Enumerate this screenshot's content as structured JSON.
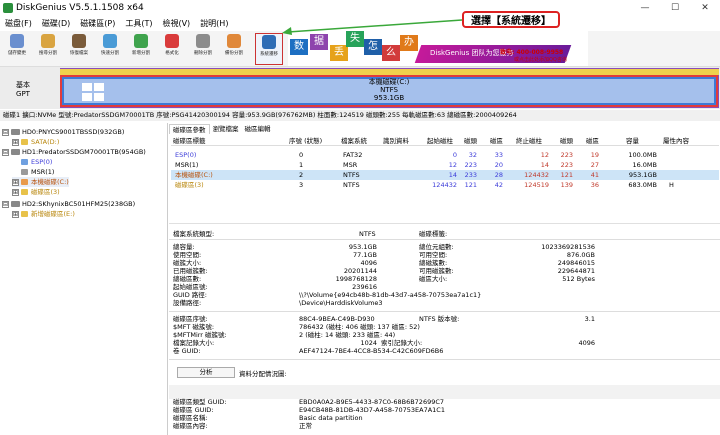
{
  "window": {
    "title": "DiskGenius V5.5.1.1508 x64",
    "minimize": "—",
    "maximize": "☐",
    "close": "✕"
  },
  "menu": [
    "磁盘(F)",
    "磁碟(D)",
    "磁碟區(P)",
    "工具(T)",
    "檢視(V)",
    "說明(H)"
  ],
  "toolbar": [
    {
      "label": "儲存變更",
      "icon": "save-icon",
      "color": "#6a8fcf"
    },
    {
      "label": "搜尋分割",
      "icon": "search-icon",
      "color": "#d9a441"
    },
    {
      "label": "恢復檔案",
      "icon": "recover-file-icon",
      "color": "#7a5b3a"
    },
    {
      "label": "快速分割",
      "icon": "quick-partition-icon",
      "color": "#4a9bd6"
    },
    {
      "label": "新增分割",
      "icon": "new-partition-icon",
      "color": "#3fa34d"
    },
    {
      "label": "格式化",
      "icon": "format-icon",
      "color": "#d93b3b"
    },
    {
      "label": "刪除分割",
      "icon": "delete-partition-icon",
      "color": "#8c8c8c"
    },
    {
      "label": "備份分割",
      "icon": "backup-partition-icon",
      "color": "#e0883a"
    },
    {
      "label": "系統遷移",
      "icon": "system-migration-icon",
      "color": "#2f6db5"
    }
  ],
  "banner": {
    "chars": [
      "数",
      "据",
      "丢",
      "失",
      "怎",
      "么",
      "办"
    ],
    "brand": "DiskGenius 团队为您服务",
    "phone": "致电: 400-008-9958",
    "qq": "或点击此处添加QQ咨询"
  },
  "callout": "選擇【系統遷移】",
  "diskbar": {
    "label_line1": "基本",
    "label_line2": "GPT",
    "part_name": "本機磁碟(C:)",
    "part_fs": "NTFS",
    "part_size": "953.1GB"
  },
  "infobar": "磁碟1 擴口:NVMe  型號:PredatorSSDGM70001TB  序號:PSG41420300194  容量:953.9GB(976762MB)  柱面數:124519  磁頭數:255  每軌磁區數:63  總磁區數:2000409264",
  "tree": [
    {
      "label": "HD0:PNYCS9001TBSSD(932GB)",
      "type": "disk",
      "expander": "⊟",
      "color": "#000"
    },
    {
      "label": "SATA(D:)",
      "type": "part",
      "expander": "⊞",
      "color": "#b8860b",
      "pcolor": "#e8c24a"
    },
    {
      "label": "HD1:PredatorSSDGM70001TB(954GB)",
      "type": "disk",
      "expander": "⊟",
      "color": "#000"
    },
    {
      "label": "ESP(0)",
      "type": "part",
      "expander": "",
      "color": "#3b3bd9",
      "pcolor": "#6fa0e0"
    },
    {
      "label": "MSR(1)",
      "type": "part",
      "expander": "",
      "color": "#000",
      "pcolor": "#9a9a9a"
    },
    {
      "label": "本機磁碟(C:)",
      "type": "part",
      "expander": "⊞",
      "color": "#b8520b",
      "pcolor": "#e89a4a"
    },
    {
      "label": "磁碟區(3)",
      "type": "part",
      "expander": "⊞",
      "color": "#b8860b",
      "pcolor": "#e8c24a"
    },
    {
      "label": "HD2:SKhynixBC501HFM25(238GB)",
      "type": "disk",
      "expander": "⊟",
      "color": "#000"
    },
    {
      "label": "新增磁碟區(E:)",
      "type": "part",
      "expander": "⊞",
      "color": "#b8860b",
      "pcolor": "#e8c24a"
    }
  ],
  "tabs": [
    "磁碟區參數",
    "瀏覽檔案",
    "磁區編輯"
  ],
  "ptable": {
    "headers": [
      "磁碟區標籤",
      "序號 (狀態)",
      "檔案系統",
      "識別資料",
      "起始磁柱",
      "磁頭",
      "磁區",
      "終止磁柱",
      "磁頭",
      "磁區",
      "容量",
      "屬性內容"
    ],
    "rows": [
      [
        "ESP(0)",
        "0",
        "FAT32",
        "",
        "0",
        "32",
        "33",
        "12",
        "223",
        "19",
        "100.0MB",
        ""
      ],
      [
        "MSR(1)",
        "1",
        "MSR",
        "",
        "12",
        "223",
        "20",
        "14",
        "223",
        "27",
        "16.0MB",
        ""
      ],
      [
        "本機磁碟(C:)",
        "2",
        "NTFS",
        "",
        "14",
        "233",
        "28",
        "124432",
        "121",
        "41",
        "953.1GB",
        ""
      ],
      [
        "磁碟區(3)",
        "3",
        "NTFS",
        "",
        "124432",
        "121",
        "42",
        "124519",
        "139",
        "36",
        "683.0MB",
        "H"
      ]
    ]
  },
  "details": {
    "fs_type_label": "檔案系統類型:",
    "fs_type": "NTFS",
    "vol_label": "磁碟標籤:",
    "left": [
      [
        "總容量:",
        "953.1GB"
      ],
      [
        "使用空間:",
        "77.1GB"
      ],
      [
        "磁簇大小:",
        "4096"
      ],
      [
        "已用磁簇數:",
        "20201144"
      ],
      [
        "總磁區數:",
        "1998768128"
      ],
      [
        "起始磁區號:",
        "239616"
      ]
    ],
    "right": [
      [
        "總位元組數:",
        "1023369281536"
      ],
      [
        "可用空間:",
        "876.0GB"
      ],
      [
        "總磁簇數:",
        "249846015"
      ],
      [
        "可用磁簇數:",
        "229644871"
      ],
      [
        "磁區大小:",
        "512 Bytes"
      ]
    ],
    "guid_path_label": "GUID 路徑:",
    "guid_path": "\\\\?\\Volume{e94cb48b-81db-43d7-a458-70753ea7a1c1}",
    "device_path_label": "設備路徑:",
    "device_path": "\\Device\\HarddiskVolume3",
    "serial_label": "磁碟區序號:",
    "serial": "88C4-9BEA-C49B-D930",
    "ntfs_ver_label": "NTFS 版本號:",
    "ntfs_ver": "3.1",
    "mft_label": "$MFT 磁簇號:",
    "mft": "786432 (磁柱: 406 磁頭: 137 磁區: 52)",
    "mftmirr_label": "$MFTMirr 磁簇號:",
    "mftmirr": "2 (磁柱: 14 磁頭: 233 磁區: 44)",
    "frs_label": "檔案記錄大小:",
    "frs": "1024",
    "idx_label": "索引記錄大小:",
    "idx": "4096",
    "vguid_label": "卷 GUID:",
    "vguid": "AEF47124-7BE4-4CC8-B534-C42C609FD6B6",
    "analyze_button": "分析",
    "analyze_text": "資料分配情況圖:",
    "type_guid_label": "磁碟區類型 GUID:",
    "type_guid": "EBD0A0A2-B9E5-4433-87C0-68B6B72699C7",
    "part_guid_label": "磁碟區 GUID:",
    "part_guid": "E94CB48B-81DB-43D7-A458-70753EA7A1C1",
    "part_name_label": "磁碟區名稱:",
    "part_name": "Basic data partition",
    "part_attr_label": "磁碟區內容:",
    "part_attr": "正常"
  }
}
